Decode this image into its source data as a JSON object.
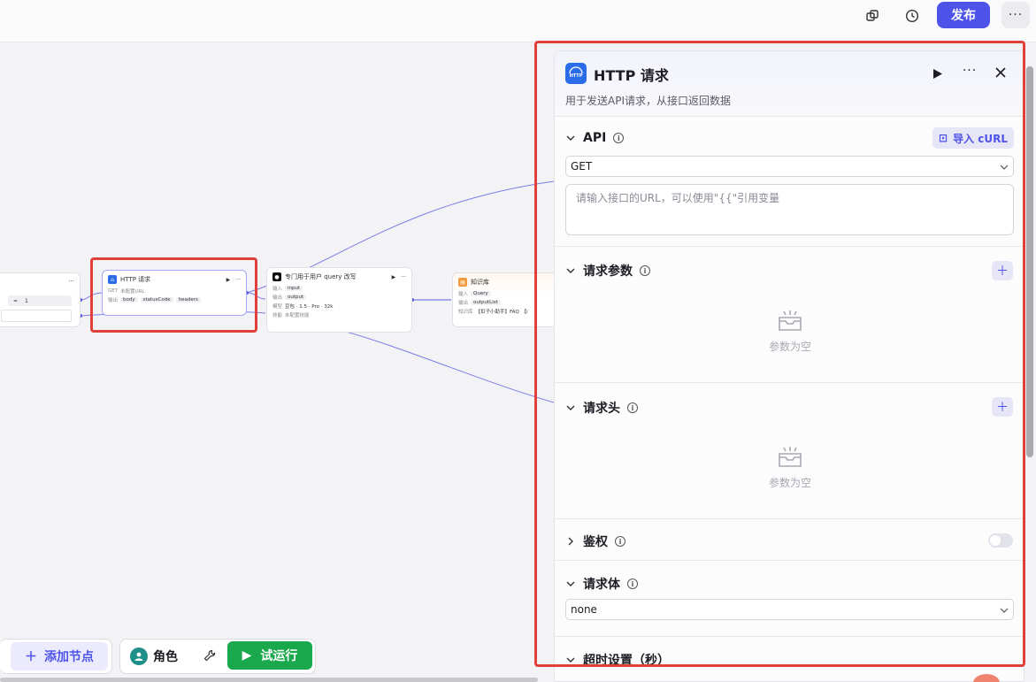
{
  "topbar": {
    "publish_label": "发布",
    "more_label": "···"
  },
  "canvas": {
    "left_node": {
      "operator": "=",
      "value": "1",
      "ctrl": "···"
    },
    "http_node": {
      "title": "HTTP 请求",
      "method": "GET",
      "url_status": "未配置URL",
      "output_label": "输出",
      "outputs": [
        "body",
        "statusCode",
        "headers"
      ],
      "ctrl": "···"
    },
    "rewrite_node": {
      "title": "专门用于用户 query 改写",
      "input_label": "输入",
      "input_value": "input",
      "output_label": "输出",
      "output_value": "output",
      "model_label": "模型",
      "model_value": "豆包 · 1.5 · Pro · 32k",
      "skill_label": "技能",
      "skill_value": "未配置技能",
      "ctrl": "···"
    },
    "kb_node": {
      "title": "知识库",
      "input_label": "输入",
      "input_value": "Query",
      "output_label": "输出",
      "output_value": "outputList",
      "kb_label": "知识库",
      "kb_value": "【扣子小助手】FAQ",
      "kb_value2": "【i"
    }
  },
  "bottom_toolbar": {
    "add_node_label": "添加节点",
    "role_label": "角色",
    "run_label": "试运行"
  },
  "panel": {
    "title": "HTTP 请求",
    "description": "用于发送API请求，从接口返回数据",
    "more_label": "···",
    "api": {
      "title": "API",
      "import_label": "导入 cURL",
      "method": "GET",
      "url_placeholder": "请输入接口的URL，可以使用\"{{\"引用变量"
    },
    "params": {
      "title": "请求参数",
      "empty_text": "参数为空"
    },
    "headers": {
      "title": "请求头",
      "empty_text": "参数为空"
    },
    "auth": {
      "title": "鉴权",
      "enabled": false
    },
    "body": {
      "title": "请求体",
      "type": "none"
    },
    "timeout": {
      "title": "超时设置（秒）"
    }
  },
  "colors": {
    "accent": "#4d53e8",
    "run_green": "#19a84b",
    "highlight_red": "#e0403a",
    "http_icon_blue": "#2b6de8"
  }
}
